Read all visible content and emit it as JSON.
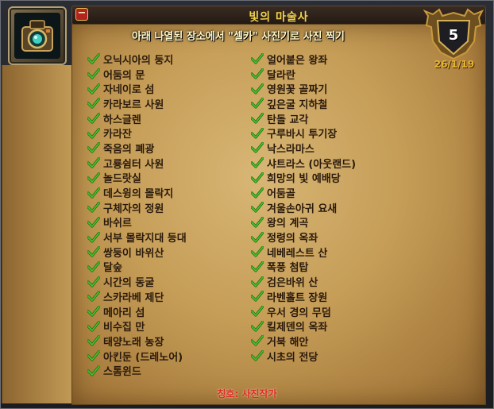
{
  "window": {
    "title": "빛의 마술사",
    "collapse_label": "−"
  },
  "achievement": {
    "description": "아래 나열된 장소에서 \"셀카\" 사진기로 사진 찍기",
    "points": "5",
    "date": "26/1/19",
    "reward": "칭호: 사진작가",
    "icon": "camera-icon",
    "accent_color": "#f2d24a",
    "reward_color": "#e12929"
  },
  "criteria_left": [
    "오닉시아의 둥지",
    "어둠의 문",
    "자네이로 섬",
    "카라보르 사원",
    "하스글렌",
    "카라잔",
    "죽음의 폐광",
    "고룡쉼터 사원",
    "놀드랏실",
    "데스윙의 몰락지",
    "구체자의 정원",
    "바쉬르",
    "서부 몰락지대 등대",
    "쌍둥이 바위산",
    "달숲",
    "시간의 동굴",
    "스카라베 제단",
    "메아리 섬",
    "비수집 만",
    "태양노래 농장",
    "아킨둔 (드레노어)",
    "스톰윈드"
  ],
  "criteria_right": [
    "얼어붙은 왕좌",
    "달라란",
    "영원꽃 골짜기",
    "깊은굴 지하철",
    "탄돌 교각",
    "구루바시 투기장",
    "낙스라마스",
    "샤트라스 (아웃랜드)",
    "희망의 빛 예배당",
    "어둠골",
    "겨울손아귀 요새",
    "왕의 계곡",
    "정령의 옥좌",
    "네베레스트 산",
    "폭풍 첨탑",
    "검은바위 산",
    "라벤홀트 장원",
    "우서 경의 무덤",
    "킬제덴의 옥좌",
    "거북 해안",
    "시초의 전당"
  ]
}
